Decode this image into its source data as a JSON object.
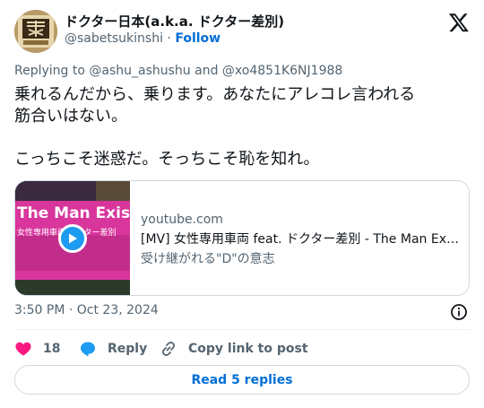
{
  "author": {
    "display_name": "ドクター日本(a.k.a. ドクター差別)",
    "handle": "@sabetsukinshi",
    "separator": "·",
    "follow_label": "Follow",
    "avatar_icon": "kanji-seal-avatar"
  },
  "replying": {
    "prefix": "Replying to",
    "mention_1": "@ashu_ashushu",
    "and": "and",
    "mention_2": "@xo4851K6NJ1988"
  },
  "tweet": {
    "line_1": "乗れるんだから、乗ります。あなたにアレコレ言われる",
    "line_2": "筋合いはない。",
    "line_3": "こっちこそ迷惑だ。そっちこそ恥を知れ。"
  },
  "link_card": {
    "thumb_text": "The Man Exist",
    "thumb_subtext": "女性専用車両 ドクター差別",
    "domain": "youtube.com",
    "title": "[MV] 女性専用車両 feat. ドクター差別 - The Man Exists",
    "description": "受け継がれる\"D\"の意志"
  },
  "meta": {
    "timestamp": "3:50 PM · Oct 23, 2024"
  },
  "actions": {
    "like_count": "18",
    "reply_label": "Reply",
    "copy_label": "Copy link to post"
  },
  "read_replies_label": "Read 5 replies",
  "colors": {
    "link_blue": "#006fd6",
    "like_pink": "#f91880",
    "reply_blue": "#1d9bf0",
    "muted": "#536471",
    "border": "#cfd9de"
  }
}
